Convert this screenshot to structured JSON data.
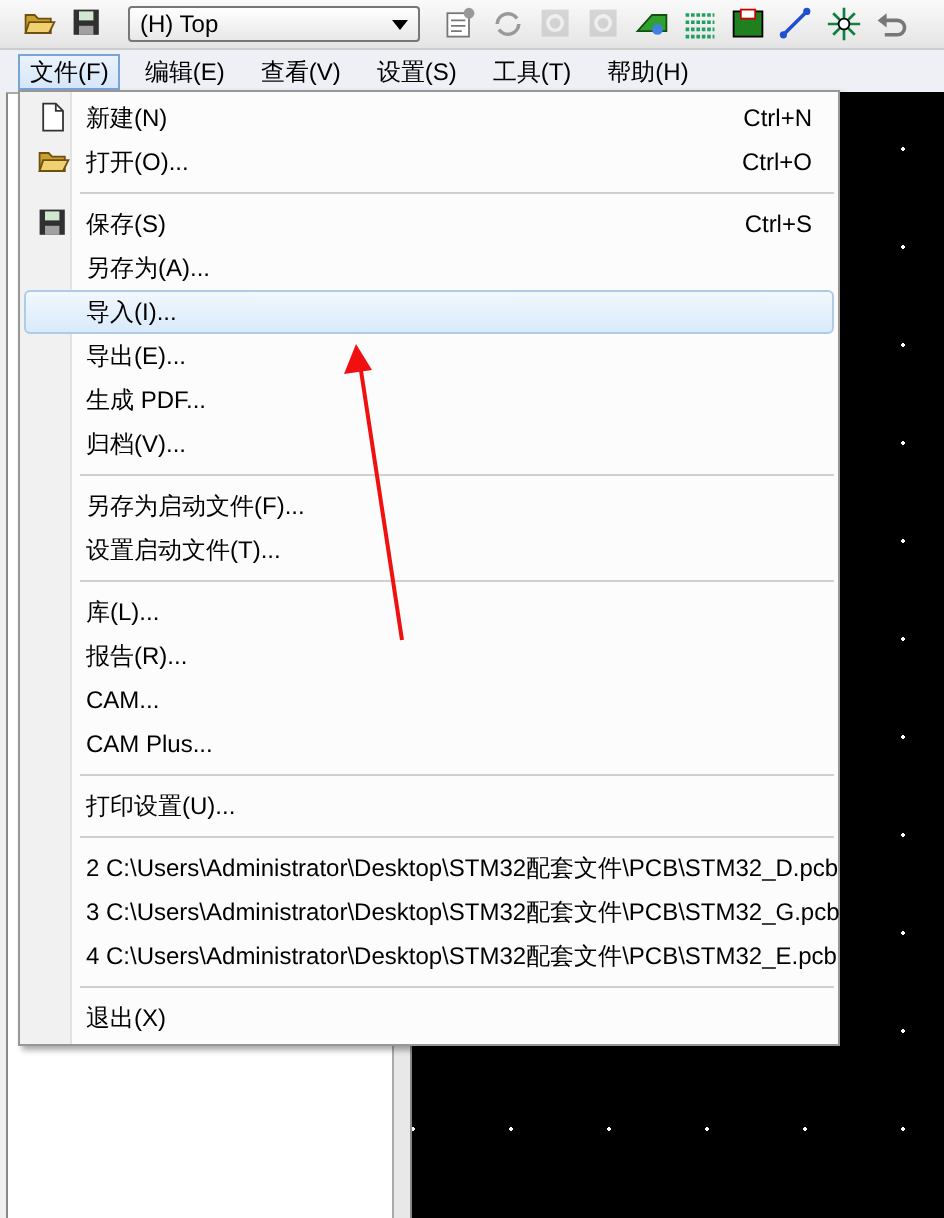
{
  "toolbar": {
    "layer_select": {
      "value": "(H) Top"
    },
    "buttons": [
      {
        "kind": "open",
        "disabled": false
      },
      {
        "kind": "save",
        "disabled": false
      },
      {
        "kind": "combo"
      },
      {
        "kind": "properties",
        "disabled": false
      },
      {
        "kind": "refresh",
        "disabled": false
      },
      {
        "kind": "gear",
        "disabled": true
      },
      {
        "kind": "gear",
        "disabled": true
      },
      {
        "kind": "board",
        "disabled": false
      },
      {
        "kind": "dots",
        "disabled": false
      },
      {
        "kind": "pcb",
        "disabled": false
      },
      {
        "kind": "line",
        "disabled": false
      },
      {
        "kind": "burst",
        "disabled": false
      },
      {
        "kind": "undo",
        "disabled": false
      }
    ]
  },
  "menubar": [
    {
      "label": "文件(F)",
      "selected": true
    },
    {
      "label": "编辑(E)",
      "selected": false
    },
    {
      "label": "查看(V)",
      "selected": false
    },
    {
      "label": "设置(S)",
      "selected": false
    },
    {
      "label": "工具(T)",
      "selected": false
    },
    {
      "label": "帮助(H)",
      "selected": false
    }
  ],
  "file_menu": [
    {
      "kind": "new",
      "label": "新建(N)",
      "shortcut": "Ctrl+N",
      "selected": false
    },
    {
      "kind": "open",
      "label": "打开(O)...",
      "shortcut": "Ctrl+O",
      "selected": false
    },
    {
      "kind": "separator"
    },
    {
      "kind": "save",
      "label": "保存(S)",
      "shortcut": "Ctrl+S",
      "selected": false
    },
    {
      "kind": "item",
      "label": "另存为(A)...",
      "selected": false
    },
    {
      "kind": "item",
      "label": "导入(I)...",
      "selected": true
    },
    {
      "kind": "item",
      "label": "导出(E)...",
      "selected": false
    },
    {
      "kind": "item",
      "label": "生成 PDF...",
      "selected": false
    },
    {
      "kind": "item",
      "label": "归档(V)...",
      "selected": false
    },
    {
      "kind": "separator"
    },
    {
      "kind": "item",
      "label": "另存为启动文件(F)...",
      "selected": false
    },
    {
      "kind": "item",
      "label": "设置启动文件(T)...",
      "selected": false
    },
    {
      "kind": "separator"
    },
    {
      "kind": "item",
      "label": "库(L)...",
      "selected": false
    },
    {
      "kind": "item",
      "label": "报告(R)...",
      "selected": false
    },
    {
      "kind": "item",
      "label": "CAM...",
      "selected": false
    },
    {
      "kind": "item",
      "label": "CAM Plus...",
      "selected": false
    },
    {
      "kind": "separator"
    },
    {
      "kind": "item",
      "label": "打印设置(U)...",
      "selected": false
    },
    {
      "kind": "separator"
    },
    {
      "kind": "item",
      "label": "2 C:\\Users\\Administrator\\Desktop\\STM32配套文件\\PCB\\STM32_D.pcb",
      "selected": false
    },
    {
      "kind": "item",
      "label": "3 C:\\Users\\Administrator\\Desktop\\STM32配套文件\\PCB\\STM32_G.pcb",
      "selected": false
    },
    {
      "kind": "item",
      "label": "4 C:\\Users\\Administrator\\Desktop\\STM32配套文件\\PCB\\STM32_E.pcb",
      "selected": false
    },
    {
      "kind": "separator"
    },
    {
      "kind": "item",
      "label": "退出(X)",
      "selected": false
    }
  ]
}
